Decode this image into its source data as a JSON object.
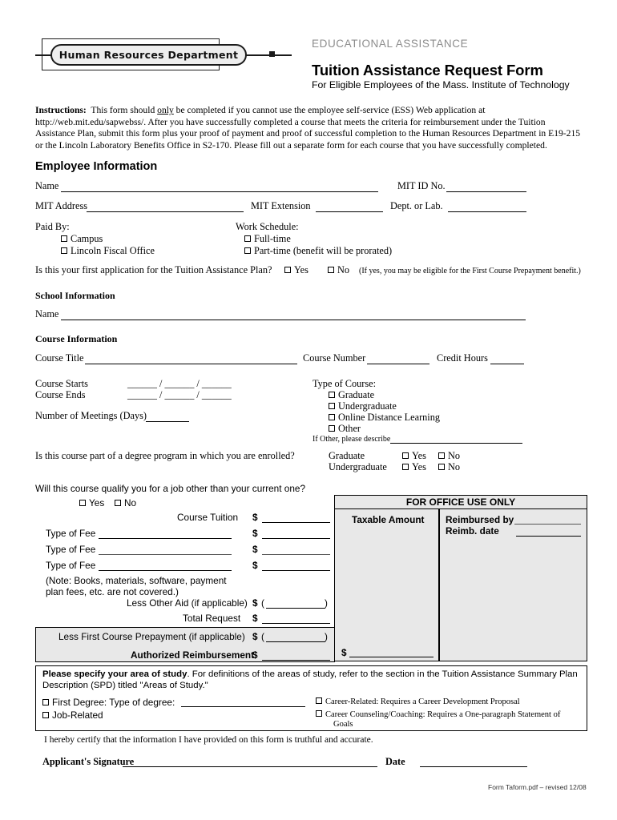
{
  "logo": {
    "text": "Human Resources Department"
  },
  "header": {
    "kicker": "EDUCATIONAL ASSISTANCE",
    "title": "Tuition Assistance Request Form",
    "subtitle": "For Eligible Employees of the Mass. Institute of Technology"
  },
  "instructions": {
    "label": "Instructions:",
    "text_1": "This form should ",
    "underlined": "only",
    "text_2": " be completed if you cannot use the employee self-service (ESS) Web application at http://web.mit.edu/sapwebss/. After you have successfully completed a course that meets the criteria for reimbursement under the Tuition Assistance Plan, submit this form plus your proof of payment and proof of successful completion to the Human Resources Department in E19-215 or the Lincoln Laboratory Benefits Office in S2-170. Please fill out a separate form for each course that you have successfully completed."
  },
  "employee": {
    "heading": "Employee Information",
    "name_label": "Name",
    "mit_id_label": "MIT ID No.",
    "address_label": "MIT Address",
    "extension_label": "MIT Extension",
    "dept_label": "Dept. or Lab.",
    "paid_by_label": "Paid By:",
    "paid_by_options": [
      "Campus",
      "Lincoln Fiscal Office"
    ],
    "work_schedule_label": "Work Schedule:",
    "work_schedule_options": [
      "Full-time",
      "Part-time (benefit will be prorated)"
    ],
    "first_app_question": "Is this your first application for the Tuition Assistance Plan?",
    "yes_label": "Yes",
    "no_label": "No",
    "first_app_note": "(If yes, you may be eligible for the First Course Prepayment benefit.)"
  },
  "school": {
    "heading": "School Information",
    "name_label": "Name"
  },
  "course": {
    "heading": "Course Information",
    "title_label": "Course Title",
    "number_label": "Course Number",
    "credit_hours_label": "Credit Hours",
    "starts_label": "Course Starts",
    "ends_label": "Course Ends",
    "date_pattern": "______ / ______ / ______",
    "meetings_label": "Number of Meetings (Days)",
    "type_label": "Type of Course:",
    "type_options": [
      "Graduate",
      "Undergraduate",
      "Online Distance Learning",
      "Other"
    ],
    "if_other_label": "If Other, please describe",
    "degree_question": "Is this course part of a degree program in which you are enrolled?",
    "degree_rows": [
      {
        "label": "Graduate",
        "yes": "Yes",
        "no": "No"
      },
      {
        "label": "Undergraduate",
        "yes": "Yes",
        "no": "No"
      }
    ],
    "job_question": "Will this course qualify you for a job other than your current one?",
    "job_yes": "Yes",
    "job_no": "No"
  },
  "fees": {
    "course_tuition_label": "Course Tuition",
    "type_of_fee_label": "Type of Fee",
    "note": "(Note:  Books, materials, software, payment plan fees, etc. are not covered.)",
    "less_other_aid_label": "Less Other Aid (if applicable)",
    "total_request_label": "Total Request",
    "less_prepayment_label": "Less First Course Prepayment (if applicable)",
    "authorized_reimb_label": "Authorized Reimbursement",
    "currency_symbol": "$",
    "paren_open": "(",
    "paren_close": ")"
  },
  "office": {
    "title": "FOR OFFICE USE ONLY",
    "taxable_amount_label": "Taxable Amount",
    "reimbursed_by_label": "Reimbursed by",
    "reimb_date_label": "Reimb. date",
    "currency_symbol": "$"
  },
  "study": {
    "lead_bold": "Please specify your area of study",
    "lead_rest": ". For definitions of the areas of study, refer to the section in the Tuition Assistance Summary Plan Description (SPD) titled \"Areas of Study.\"",
    "first_degree_label": "First Degree:  Type of degree:",
    "job_related_label": "Job-Related",
    "career_related_label": "Career-Related: Requires a Career Development Proposal",
    "career_counseling_label": "Career Counseling/Coaching: Requires a One-paragraph Statement of",
    "career_counseling_label_2": "Goals"
  },
  "certify": {
    "text": "I hereby certify that the information I have provided on this form is truthful and accurate.",
    "signature_label": "Applicant's Signature",
    "date_label": "Date"
  },
  "footer": {
    "note": "Form Taform.pdf – revised 12/08"
  },
  "colors": {
    "kicker_gray": "#8c8c8c",
    "shade_gray": "#e8e8e8",
    "ink": "#000000"
  }
}
